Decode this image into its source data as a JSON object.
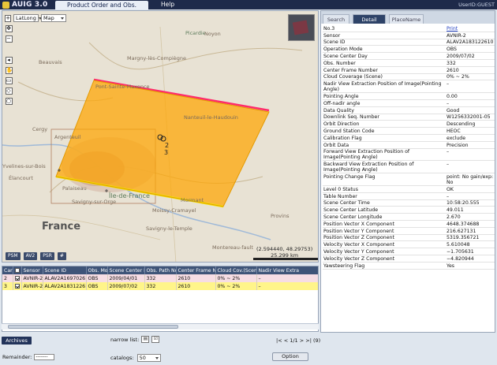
{
  "app": {
    "name": "AUIG 3.0",
    "active_tab": "Product Order and Obs. Request",
    "help_menu": "Help",
    "user": "UserID:GUEST"
  },
  "map": {
    "latlong_select": "LatLong",
    "maptype_select": "Map",
    "labels": [
      "Picardie",
      "Noyon",
      "Beauvais",
      "Margny-lès-Compiègne",
      "Pont-Sainte-Maxence",
      "Nanteuil-le-Haudouin",
      "Cergy",
      "Argenteuil",
      "Yvelines-sur-Bois",
      "Élancourt",
      "Palaiseau",
      "Île-de-France",
      "Savigny-sur-Orge",
      "Mormant",
      "Moissy-Cramayel",
      "Provins",
      "Savigny-le-Temple",
      "Montereau-fault",
      "France"
    ],
    "scene_labels": [
      "2",
      "3"
    ],
    "coordinate_readout": "(2.594440, 48.29753)",
    "scale_text": "25.299 km",
    "layer_buttons": [
      "PSM",
      "AV2",
      "PSR",
      "#"
    ]
  },
  "table": {
    "columns": [
      "Cart",
      "",
      "Sensor",
      "Scene ID",
      "Obs. Mode",
      "Scene Center Day",
      "Obs. Path No.",
      "Center Frame No.",
      "Cloud Cov.(Scene)",
      "Nadir View Extra"
    ],
    "rows": [
      [
        "2",
        "",
        "AVNIR-2",
        "ALAV2A169702610",
        "OBS",
        "2009/04/01",
        "332",
        "2610",
        "0% ~ 2%",
        "–"
      ],
      [
        "3",
        "",
        "AVNIR-2",
        "ALAV2A183122610",
        "OBS",
        "2009/07/02",
        "332",
        "2610",
        "0% ~ 2%",
        "–"
      ]
    ]
  },
  "bottom": {
    "archives_button": "Archives",
    "narrow_list_label": "narrow list:",
    "pager": "|< < 1/1 > >| (9)",
    "remainder_label": "Remainder:",
    "remainder_value": "-------",
    "catalogs_label": "catalogs:",
    "catalogs_value": "50",
    "option_button": "Option"
  },
  "panel": {
    "tabs": [
      "Search",
      "Detail",
      "PlaceName"
    ],
    "active_tab": "Detail",
    "details": [
      [
        "No.3",
        "Print"
      ],
      [
        "Sensor",
        "AVNIR-2"
      ],
      [
        "Scene ID",
        "ALAV2A183122610"
      ],
      [
        "Operation Mode",
        "OBS"
      ],
      [
        "Scene Center Day",
        "2009/07/02"
      ],
      [
        "Obs. Number",
        "332"
      ],
      [
        "Center Frame Number",
        "2610"
      ],
      [
        "Cloud Coverage (Scene)",
        "0% ~ 2%"
      ],
      [
        "Nadir View Extraction Position of Image(Pointing Angle)",
        "–"
      ],
      [
        "Pointing Angle",
        "0.00"
      ],
      [
        "Off-nadir angle",
        "–"
      ],
      [
        "Data Quality",
        "Good"
      ],
      [
        "Downlink Seq. Number",
        "W1256332001-05"
      ],
      [
        "Orbit Direction",
        "Descending"
      ],
      [
        "Ground Station Code",
        "HEOC"
      ],
      [
        "Calibration Flag",
        "exclude"
      ],
      [
        "Orbit Data",
        "Precision"
      ],
      [
        "Forward View Extraction Position of Image(Pointing Angle)",
        "–"
      ],
      [
        "Backward View Extraction Position of Image(Pointing Angle)",
        "–"
      ],
      [
        "Pointing Change Flag",
        "point: No gain/exp: No"
      ],
      [
        "Level 0 Status",
        "OK"
      ],
      [
        "Table Number",
        "–"
      ],
      [
        "Scene Center Time",
        "10:58:20.555"
      ],
      [
        "Scene Center Latitude",
        "49.011"
      ],
      [
        "Scene Center Longitude",
        "2.670"
      ],
      [
        "Position Vector X Component",
        "4648.374688"
      ],
      [
        "Position Vector Y Component",
        "216.627131"
      ],
      [
        "Position Vector Z Component",
        "5319.356721"
      ],
      [
        "Velocity Vector X Component",
        "5.610048"
      ],
      [
        "Velocity Vector Y Component",
        "−1.705631"
      ],
      [
        "Velocity Vector Z Component",
        "−4.820944"
      ],
      [
        "Yawsteering Flag",
        "Yes"
      ]
    ]
  },
  "colors": {
    "footprint_fill": "#ffa500",
    "footprint_border_pink": "#ff2a6a",
    "footprint_border_yellow": "#f3e600",
    "header_blue": "#3e5478",
    "row_pink": "#f6dde4",
    "row_yellow": "#fff58a"
  }
}
